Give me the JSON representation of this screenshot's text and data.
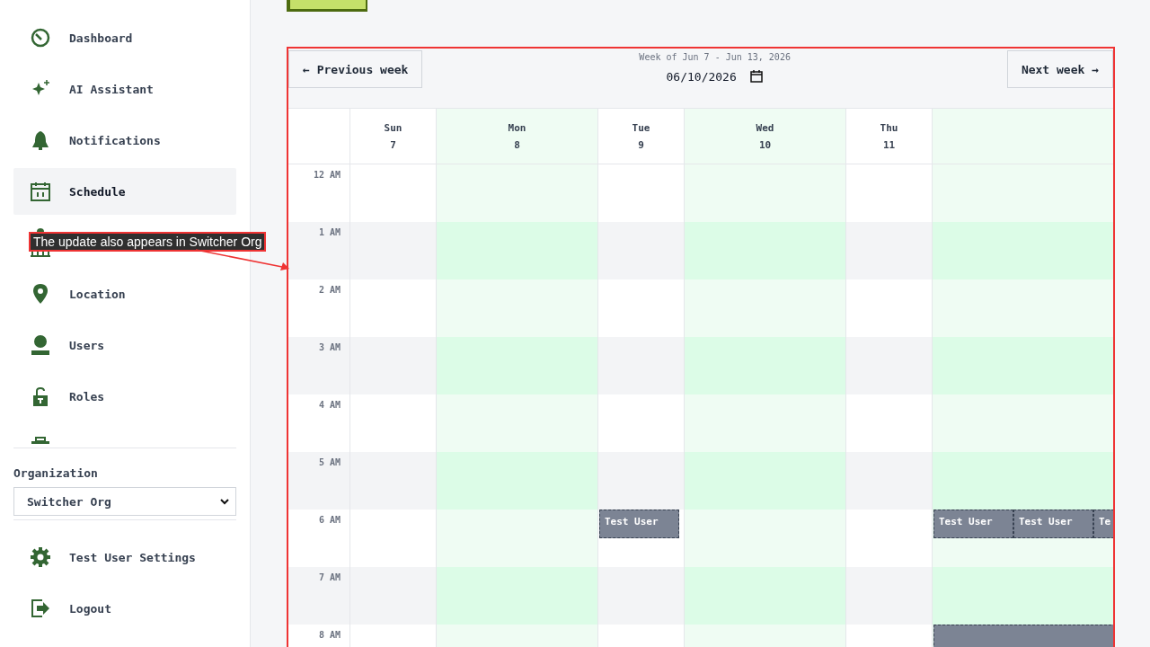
{
  "sidebar": {
    "items": [
      {
        "label": "Dashboard",
        "selected": false
      },
      {
        "label": "AI Assistant",
        "selected": false
      },
      {
        "label": "Notifications",
        "selected": false
      },
      {
        "label": "Schedule",
        "selected": true
      },
      {
        "selected": false
      },
      {
        "label": "Location",
        "selected": false
      },
      {
        "label": "Users",
        "selected": false
      },
      {
        "label": "Roles",
        "selected": false
      },
      {
        "selected": false
      }
    ],
    "organization": {
      "label": "Organization",
      "value": "Switcher Org"
    },
    "footer_items": [
      {
        "label": "Test User Settings"
      },
      {
        "label": "Logout"
      }
    ]
  },
  "calendar": {
    "week_label": "Week of Jun 7 - Jun 13, 2026",
    "date": "06/10/2026",
    "prev_button": "← Previous week",
    "next_button": "Next week →",
    "days": [
      {
        "name": "Sun",
        "date": "7",
        "highlighted": false
      },
      {
        "name": "Mon",
        "date": "8",
        "highlighted": true
      },
      {
        "name": "Tue",
        "date": "9",
        "highlighted": false
      },
      {
        "name": "Wed",
        "date": "10",
        "highlighted": true
      },
      {
        "name": "Thu",
        "date": "11",
        "highlighted": false
      },
      {
        "highlighted": true
      }
    ],
    "rows": [
      {
        "label": "12 AM",
        "cells": [
          {},
          {},
          {},
          {},
          {},
          {}
        ]
      },
      {
        "label": "1 AM",
        "cells": [
          {},
          {},
          {},
          {},
          {},
          {}
        ]
      },
      {
        "label": "2 AM",
        "cells": [
          {},
          {},
          {},
          {},
          {},
          {}
        ]
      },
      {
        "label": "3 AM",
        "cells": [
          {},
          {},
          {},
          {},
          {},
          {}
        ]
      },
      {
        "label": "4 AM",
        "cells": [
          {},
          {},
          {},
          {},
          {},
          {}
        ]
      },
      {
        "label": "5 AM",
        "cells": [
          {},
          {},
          {},
          {},
          {},
          {}
        ]
      },
      {
        "label": "6 AM",
        "cells": [
          {},
          {},
          {
            "events": [
              {
                "kind": "short",
                "label": "Test User"
              }
            ]
          },
          {},
          {},
          {
            "events": [
              {
                "kind": "short",
                "label": "Test User"
              },
              {
                "kind": "short",
                "label": "Test User"
              },
              {
                "kind": "short",
                "label": "Te"
              }
            ]
          }
        ]
      },
      {
        "label": "7 AM",
        "cells": [
          {},
          {},
          {},
          {},
          {},
          {}
        ]
      },
      {
        "label": "8 AM",
        "cells": [
          {},
          {},
          {},
          {},
          {},
          {
            "events": [
              {
                "kind": "long"
              }
            ]
          }
        ]
      }
    ]
  },
  "callout": {
    "text": "The update also appears in Switcher Org"
  }
}
